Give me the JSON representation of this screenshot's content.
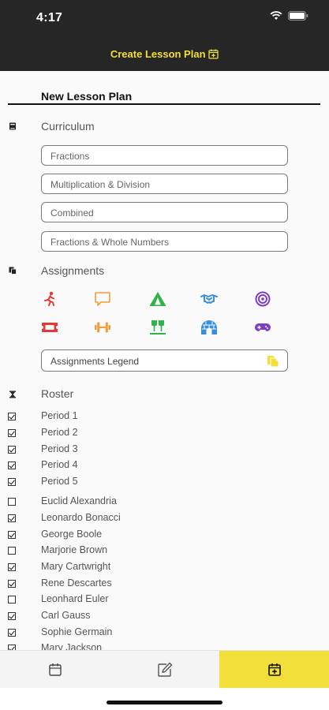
{
  "status_bar": {
    "time": "4:17"
  },
  "header": {
    "title": "Create Lesson Plan"
  },
  "plan": {
    "title": "New Lesson Plan"
  },
  "curriculum": {
    "label": "Curriculum",
    "items": [
      "Fractions",
      "Multiplication & Division",
      "Combined",
      "Fractions & Whole Numbers"
    ]
  },
  "assignments": {
    "label": "Assignments",
    "icons": [
      {
        "name": "running-icon",
        "color": "#e53935"
      },
      {
        "name": "speech-bubble-icon",
        "color": "#f29b3a"
      },
      {
        "name": "tent-icon",
        "color": "#2db34a"
      },
      {
        "name": "handshake-icon",
        "color": "#3b8fd6"
      },
      {
        "name": "target-icon",
        "color": "#7b3fc4"
      },
      {
        "name": "ticket-icon",
        "color": "#e53935"
      },
      {
        "name": "dumbbell-icon",
        "color": "#f29b3a"
      },
      {
        "name": "goal-posts-icon",
        "color": "#2db34a"
      },
      {
        "name": "igloo-icon",
        "color": "#3b8fd6"
      },
      {
        "name": "gamepad-icon",
        "color": "#7b3fc4"
      }
    ],
    "legend_label": "Assignments Legend",
    "legend_icon_color": "#f2df3a"
  },
  "roster": {
    "label": "Roster",
    "periods": [
      {
        "label": "Period 1",
        "checked": true
      },
      {
        "label": "Period 2",
        "checked": true
      },
      {
        "label": "Period 3",
        "checked": true
      },
      {
        "label": "Period 4",
        "checked": true
      },
      {
        "label": "Period 5",
        "checked": true
      }
    ],
    "students": [
      {
        "label": "Euclid Alexandria",
        "checked": false
      },
      {
        "label": "Leonardo Bonacci",
        "checked": true
      },
      {
        "label": "George Boole",
        "checked": true
      },
      {
        "label": "Marjorie Brown",
        "checked": false
      },
      {
        "label": "Mary Cartwright",
        "checked": true
      },
      {
        "label": "Rene Descartes",
        "checked": true
      },
      {
        "label": "Leonhard Euler",
        "checked": false
      },
      {
        "label": "Carl Gauss",
        "checked": true
      },
      {
        "label": "Sophie Germain",
        "checked": true
      },
      {
        "label": "Mary Jackson",
        "checked": true
      }
    ]
  },
  "tabs": [
    {
      "name": "calendar-icon",
      "active": false
    },
    {
      "name": "edit-icon",
      "active": false
    },
    {
      "name": "calendar-add-icon",
      "active": true
    }
  ],
  "colors": {
    "accent": "#f2df3a",
    "header_bg": "#262626"
  }
}
